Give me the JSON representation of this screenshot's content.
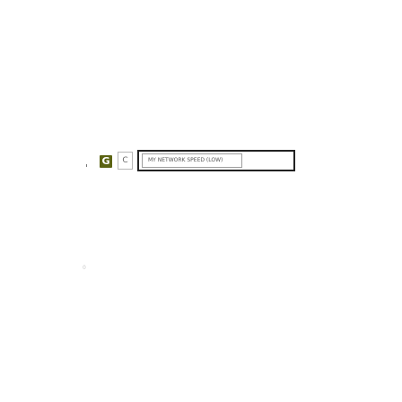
{
  "toolbar": {
    "logo_icon": "g-logo-icon",
    "logo_letter": "G",
    "c_button_label": "C",
    "network_field_text": "MY NETWORK SPEED (LOW)"
  },
  "stray_text": "0",
  "colors": {
    "logo": "#5b6312",
    "panel_border": "#222222",
    "field_border": "#9e9e9e"
  }
}
